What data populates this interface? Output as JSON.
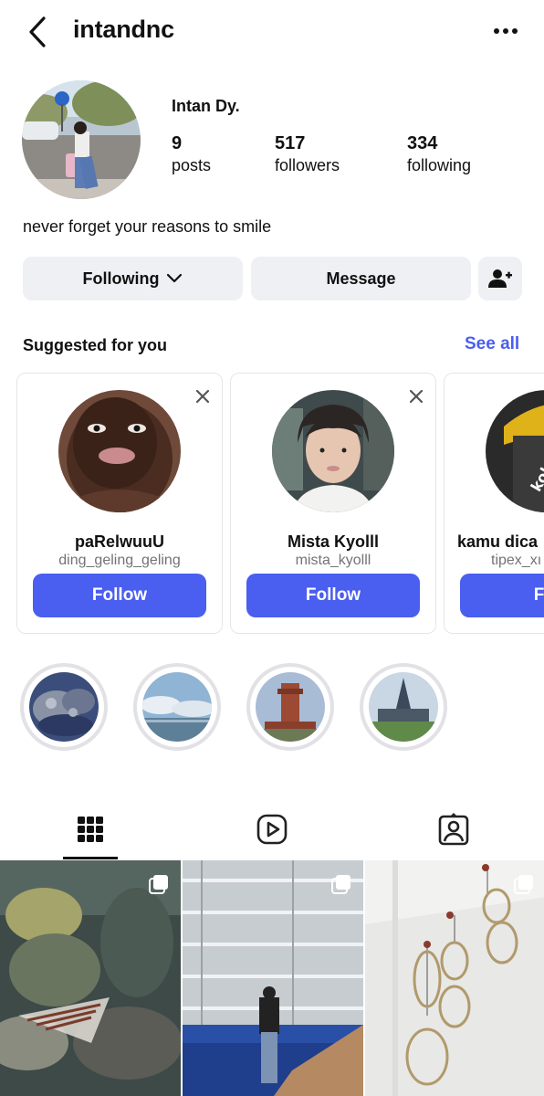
{
  "header": {
    "username": "intandnc",
    "back_icon": "chevron-left-icon",
    "more_icon": "more-horizontal-icon"
  },
  "profile": {
    "display_name": "Intan Dy.",
    "stats": {
      "posts_count": "9",
      "posts_label": "posts",
      "followers_count": "517",
      "followers_label": "followers",
      "following_count": "334",
      "following_label": "following"
    },
    "bio": "never forget your reasons to smile"
  },
  "actions": {
    "following_label": "Following",
    "message_label": "Message",
    "add_user_icon": "person-add-icon"
  },
  "suggested": {
    "title": "Suggested for you",
    "see_all": "See all",
    "users": [
      {
        "name": "paRelwuuU",
        "handle": "ding_geling_geling",
        "button": "Follow"
      },
      {
        "name": "Mista Kyolll",
        "handle": "mista_kyolll",
        "button": "Follow"
      },
      {
        "name": "kamu dica",
        "handle": "tipex_xı",
        "button": "Fol"
      }
    ]
  },
  "tabs": [
    {
      "icon": "grid-icon",
      "selected": true
    },
    {
      "icon": "reels-icon",
      "selected": false
    },
    {
      "icon": "tagged-icon",
      "selected": false
    }
  ],
  "colors": {
    "accent": "#4a5ef0",
    "button_bg": "#eff0f3",
    "muted_text": "#737373"
  }
}
